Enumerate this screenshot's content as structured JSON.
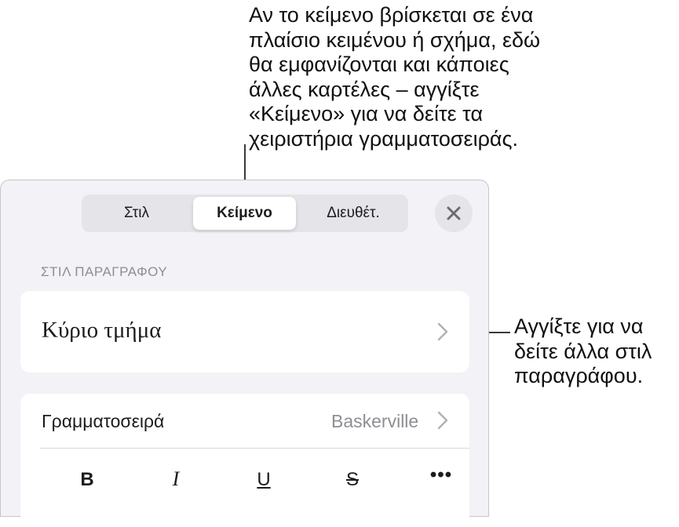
{
  "callouts": {
    "top": "Αν το κείμενο βρίσκεται σε ένα\nπλαίσιο κειμένου ή σχήμα, εδώ\nθα εμφανίζονται και κάποιες\nάλλες καρτέλες – αγγίξτε\n«Κείμενο» για να δείτε τα\nχειριστήρια γραμματοσειράς.",
    "right": "Αγγίξτε για να\nδείτε άλλα στιλ\nπαραγράφου."
  },
  "tabs": [
    {
      "label": "Στιλ"
    },
    {
      "label": "Κείμενο",
      "selected": true
    },
    {
      "label": "Διευθέτ."
    }
  ],
  "close_icon": "close-icon",
  "section": {
    "label": "ΣΤΙΛ ΠΑΡΑΓΡΑΦΟΥ"
  },
  "paragraph_style": {
    "name": "Κύριο τμήμα",
    "icon": "chevron-right-icon"
  },
  "font": {
    "label": "Γραμματοσειρά",
    "value": "Baskerville",
    "icon": "chevron-right-icon"
  },
  "format_buttons": [
    {
      "glyph": "B",
      "icon": "bold-icon"
    },
    {
      "glyph": "I",
      "icon": "italic-icon"
    },
    {
      "glyph": "U",
      "icon": "underline-icon"
    },
    {
      "glyph": "S",
      "icon": "strikethrough-icon"
    },
    {
      "glyph": "•••",
      "icon": "more-icon"
    }
  ],
  "colors": {
    "panel_bg": "#f2f2f7",
    "card_bg": "#ffffff",
    "secondary_text": "#8e8e93",
    "segment_bg": "#e4e4e9"
  }
}
